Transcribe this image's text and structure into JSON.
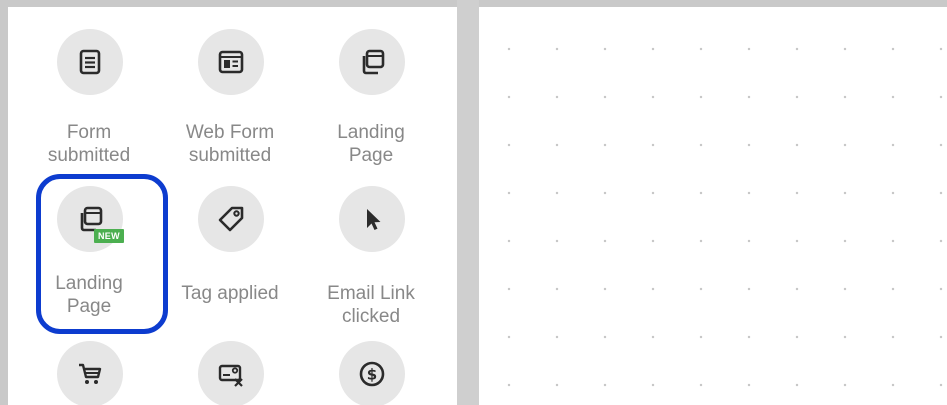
{
  "triggers": [
    {
      "label": "Form submitted",
      "icon": "form-icon"
    },
    {
      "label": "Web Form submitted",
      "icon": "web-form-icon"
    },
    {
      "label": "Landing Page",
      "icon": "landing-page-icon"
    },
    {
      "label": "Landing Page",
      "icon": "landing-page-icon",
      "badge": "NEW"
    },
    {
      "label": "Tag applied",
      "icon": "tag-icon"
    },
    {
      "label": "Email Link clicked",
      "icon": "cursor-icon"
    },
    {
      "label": "",
      "icon": "cart-icon"
    },
    {
      "label": "",
      "icon": "card-cancel-icon"
    },
    {
      "label": "",
      "icon": "dollar-icon"
    }
  ],
  "highlight_color": "#0d3ccf",
  "badge_color": "#4caf50"
}
